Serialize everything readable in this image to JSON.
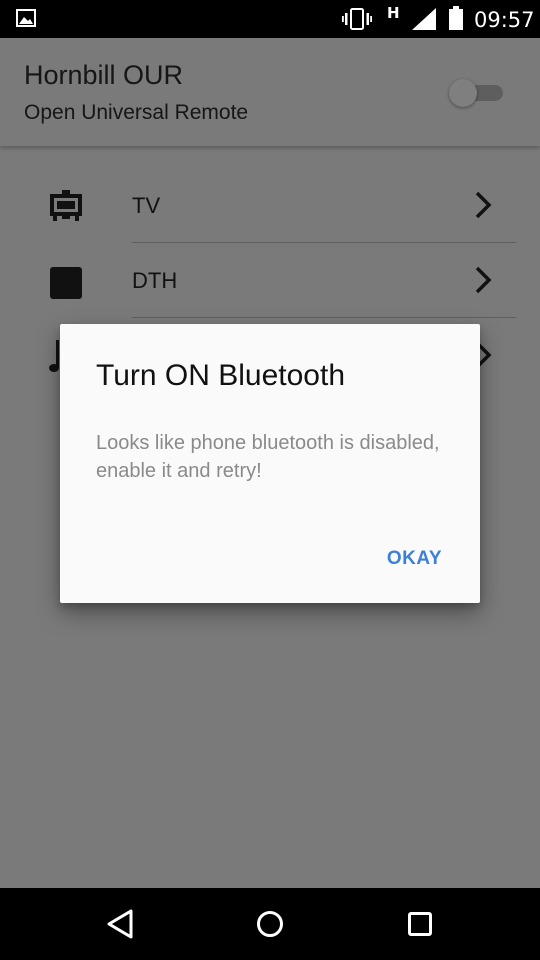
{
  "status_bar": {
    "network_type": "H",
    "time": "09:57",
    "icons": [
      "gallery-icon",
      "vibrate-icon",
      "signal-icon",
      "battery-icon"
    ]
  },
  "app_bar": {
    "title": "Hornbill OUR",
    "subtitle": "Open Universal Remote",
    "toggle_on": false
  },
  "device_list": {
    "items": [
      {
        "label": "TV",
        "icon": "tv-icon"
      },
      {
        "label": "DTH",
        "icon": "square-icon"
      },
      {
        "label": "",
        "icon": "music-note-icon"
      }
    ]
  },
  "dialog": {
    "title": "Turn ON Bluetooth",
    "message": "Looks like phone bluetooth is disabled, enable it and retry!",
    "button_label": "OKAY"
  },
  "nav_bar": {
    "icons": [
      "back-icon",
      "home-icon",
      "recents-icon"
    ]
  },
  "colors": {
    "scrim": "#7a7a7a",
    "dialog_background": "#fafafa",
    "accent": "#3d80d8",
    "status_bar": "#000000"
  }
}
